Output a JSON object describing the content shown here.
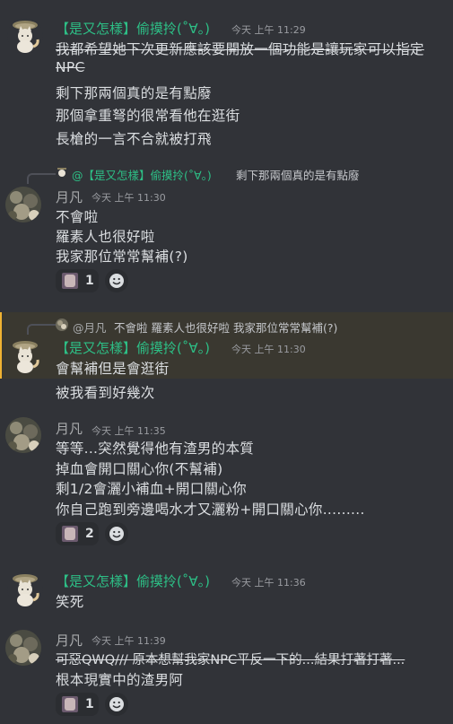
{
  "msg1": {
    "author": "【是又怎樣】偷摸拎(˚∀。)",
    "time": "今天 上午 11:29",
    "lines": [
      "我都希望她下次更新應該要開放一個功能是讓玩家可以指定",
      "NPC",
      "剩下那兩個真的是有點廢",
      "那個拿重弩的很常看他在逛街",
      "長槍的一言不合就被打飛"
    ]
  },
  "msg2": {
    "reply_author": "@【是又怎樣】偷摸拎(˚∀。)",
    "reply_text": "剩下那兩個真的是有點廢",
    "author": "月凡",
    "time": "今天 上午 11:30",
    "lines": [
      "不會啦",
      "羅素人也很好啦",
      "我家那位常常幫補(?)"
    ],
    "reaction_count": "1"
  },
  "msg3": {
    "reply_author": "@月凡",
    "reply_text": "不會啦 羅素人也很好啦 我家那位常常幫補(?)",
    "author": "【是又怎樣】偷摸拎(˚∀。)",
    "time": "今天 上午 11:30",
    "lines": [
      "會幫補但是會逛街",
      "被我看到好幾次"
    ]
  },
  "msg4": {
    "author": "月凡",
    "time": "今天 上午 11:35",
    "lines": [
      "等等...突然覺得他有渣男的本質",
      "掉血會開口關心你(不幫補)",
      "剩1/2會灑小補血+開口關心你",
      "你自己跑到旁邊喝水才又灑粉+開口關心你........."
    ],
    "reaction_count": "2"
  },
  "msg5": {
    "author": "【是又怎樣】偷摸拎(˚∀。)",
    "time": "今天 上午 11:36",
    "lines": [
      "笑死"
    ]
  },
  "msg6": {
    "author": "月凡",
    "time": "今天 上午 11:39",
    "lines": [
      "可惡QWQ/// 原本想幫我家NPC平反一下的...結果打著打著...",
      "根本現實中的渣男阿"
    ],
    "reaction_count": "1"
  },
  "icons": {
    "avatar_cat": "cat-avatar",
    "avatar_photo": "photo-avatar",
    "add_reaction": "smile-icon"
  },
  "colors": {
    "bg": "#313338",
    "green_name": "#2dbf86",
    "highlight_bar": "#f0b232"
  }
}
